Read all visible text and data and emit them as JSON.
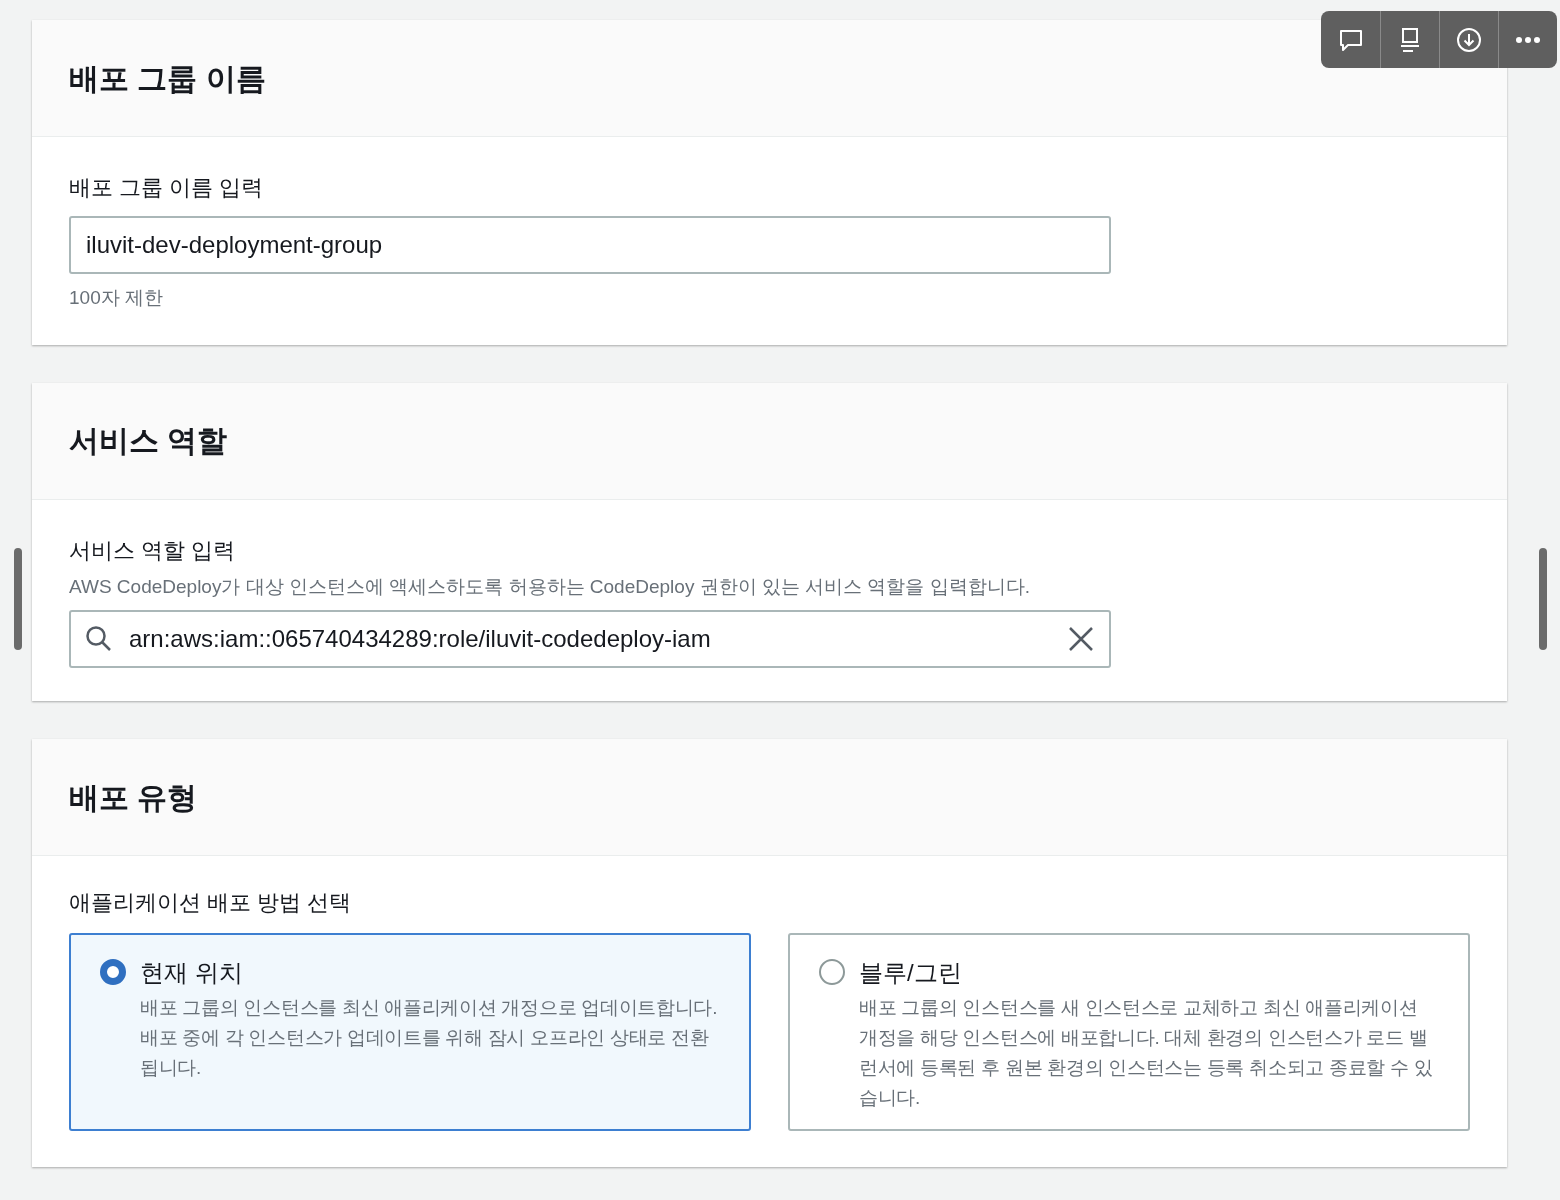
{
  "toolbar": [
    {
      "kind": "comment"
    },
    {
      "kind": "present"
    },
    {
      "kind": "download"
    },
    {
      "kind": "more"
    }
  ],
  "name_section": {
    "title": "배포 그룹 이름",
    "label": "배포 그룹 이름 입력",
    "value": "iluvit-dev-deployment-group",
    "hint": "100자 제한"
  },
  "role_section": {
    "title": "서비스 역할",
    "label": "서비스 역할 입력",
    "description": "AWS CodeDeploy가 대상 인스턴스에 액세스하도록 허용하는 CodeDeploy 권한이 있는 서비스 역할을 입력합니다.",
    "value": "arn:aws:iam::065740434289:role/iluvit-codedeploy-iam"
  },
  "type_section": {
    "title": "배포 유형",
    "label": "애플리케이션 배포 방법 선택",
    "options": [
      {
        "title": "현재 위치",
        "description": "배포 그룹의 인스턴스를 최신 애플리케이션 개정으로 업데이트합니다. 배포 중에 각 인스턴스가 업데이트를 위해 잠시 오프라인 상태로 전환됩니다.",
        "selected": true
      },
      {
        "title": "블루/그린",
        "description": "배포 그룹의 인스턴스를 새 인스턴스로 교체하고 최신 애플리케이션 개정을 해당 인스턴스에 배포합니다. 대체 환경의 인스턴스가 로드 밸런서에 등록된 후 원본 환경의 인스턴스는 등록 취소되고 종료할 수 있습니다.",
        "selected": false
      }
    ]
  }
}
